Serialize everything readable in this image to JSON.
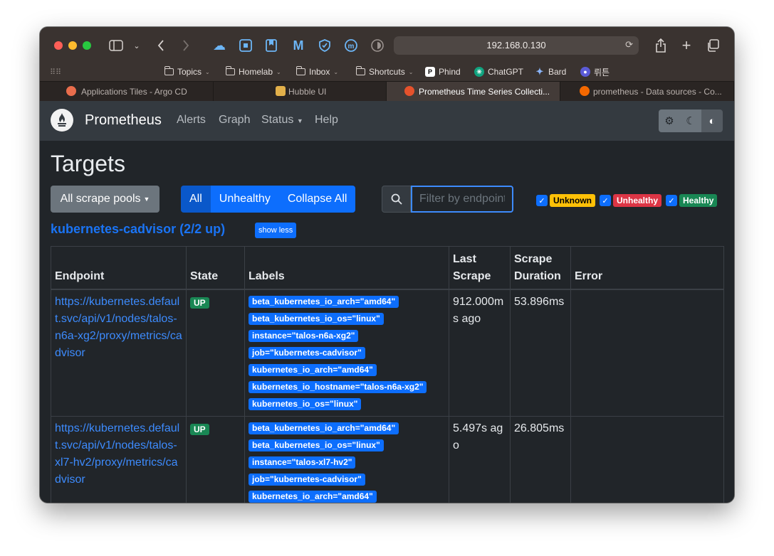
{
  "browser": {
    "url": "192.168.0.130",
    "bookmarks": [
      {
        "label": "Topics",
        "type": "folder"
      },
      {
        "label": "Homelab",
        "type": "folder"
      },
      {
        "label": "Inbox",
        "type": "folder"
      },
      {
        "label": "Shortcuts",
        "type": "folder"
      },
      {
        "label": "Phind",
        "type": "link"
      },
      {
        "label": "ChatGPT",
        "type": "link"
      },
      {
        "label": "Bard",
        "type": "link"
      },
      {
        "label": "뤼튼",
        "type": "link"
      }
    ],
    "tabs": [
      {
        "title": "Applications Tiles - Argo CD",
        "active": false
      },
      {
        "title": "Hubble UI",
        "active": false
      },
      {
        "title": "Prometheus Time Series Collecti...",
        "active": true
      },
      {
        "title": "prometheus - Data sources - Co...",
        "active": false
      }
    ]
  },
  "navbar": {
    "brand": "Prometheus",
    "links": [
      "Alerts",
      "Graph",
      "Status",
      "Help"
    ]
  },
  "page": {
    "title": "Targets",
    "scrape_pools_button": "All scrape pools",
    "filters": [
      "All",
      "Unhealthy",
      "Collapse All"
    ],
    "search_placeholder": "Filter by endpoint or labels",
    "state_badges": [
      "Unknown",
      "Unhealthy",
      "Healthy"
    ]
  },
  "pool": {
    "title": "kubernetes-cadvisor (2/2 up)",
    "toggle": "show less",
    "columns": [
      "Endpoint",
      "State",
      "Labels",
      "Last Scrape",
      "Scrape Duration",
      "Error"
    ],
    "rows": [
      {
        "endpoint": "https://kubernetes.default.svc/api/v1/nodes/talos-n6a-xg2/proxy/metrics/cadvisor",
        "state": "UP",
        "labels": [
          "beta_kubernetes_io_arch=\"amd64\"",
          "beta_kubernetes_io_os=\"linux\"",
          "instance=\"talos-n6a-xg2\"",
          "job=\"kubernetes-cadvisor\"",
          "kubernetes_io_arch=\"amd64\"",
          "kubernetes_io_hostname=\"talos-n6a-xg2\"",
          "kubernetes_io_os=\"linux\""
        ],
        "last_scrape": "912.000ms ago",
        "duration": "53.896ms",
        "error": ""
      },
      {
        "endpoint": "https://kubernetes.default.svc/api/v1/nodes/talos-xl7-hv2/proxy/metrics/cadvisor",
        "state": "UP",
        "labels": [
          "beta_kubernetes_io_arch=\"amd64\"",
          "beta_kubernetes_io_os=\"linux\"",
          "instance=\"talos-xl7-hv2\"",
          "job=\"kubernetes-cadvisor\"",
          "kubernetes_io_arch=\"amd64\""
        ],
        "last_scrape": "5.497s ago",
        "duration": "26.805ms",
        "error": ""
      }
    ]
  }
}
